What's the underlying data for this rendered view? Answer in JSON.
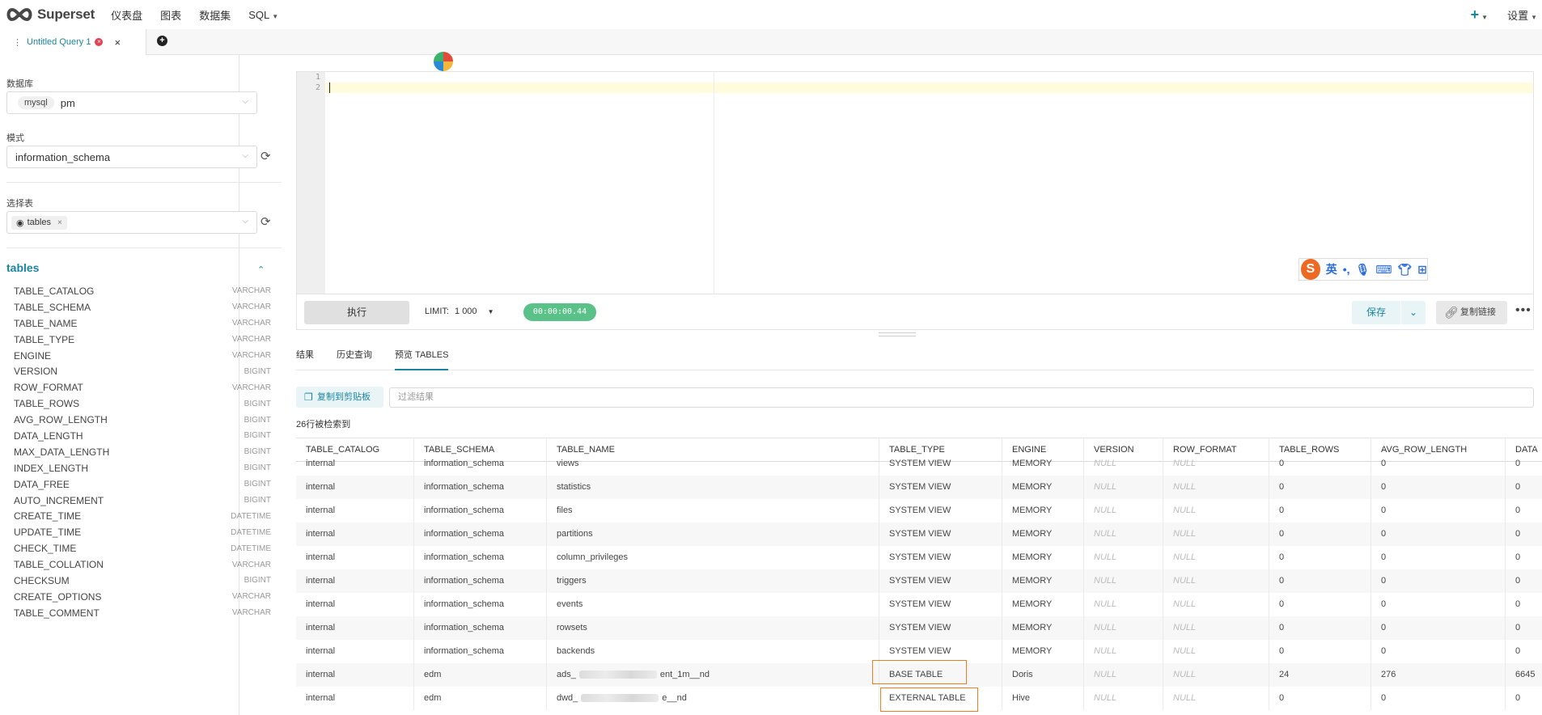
{
  "nav": {
    "brand": "Superset",
    "items": [
      "仪表盘",
      "图表",
      "数据集",
      "SQL"
    ],
    "plus": "+",
    "settings": "设置"
  },
  "tab": {
    "label": "Untitled Query 1",
    "close": "×",
    "add": "+"
  },
  "left": {
    "database_label": "数据库",
    "database_chip": "mysql",
    "database_name": "pm",
    "schema_label": "模式",
    "schema_value": "information_schema",
    "table_label": "选择表",
    "table_chip": "tables",
    "table_chip_remove": "×",
    "tables_header": "tables",
    "columns": [
      {
        "name": "TABLE_CATALOG",
        "type": "VARCHAR"
      },
      {
        "name": "TABLE_SCHEMA",
        "type": "VARCHAR"
      },
      {
        "name": "TABLE_NAME",
        "type": "VARCHAR"
      },
      {
        "name": "TABLE_TYPE",
        "type": "VARCHAR"
      },
      {
        "name": "ENGINE",
        "type": "VARCHAR"
      },
      {
        "name": "VERSION",
        "type": "BIGINT"
      },
      {
        "name": "ROW_FORMAT",
        "type": "VARCHAR"
      },
      {
        "name": "TABLE_ROWS",
        "type": "BIGINT"
      },
      {
        "name": "AVG_ROW_LENGTH",
        "type": "BIGINT"
      },
      {
        "name": "DATA_LENGTH",
        "type": "BIGINT"
      },
      {
        "name": "MAX_DATA_LENGTH",
        "type": "BIGINT"
      },
      {
        "name": "INDEX_LENGTH",
        "type": "BIGINT"
      },
      {
        "name": "DATA_FREE",
        "type": "BIGINT"
      },
      {
        "name": "AUTO_INCREMENT",
        "type": "BIGINT"
      },
      {
        "name": "CREATE_TIME",
        "type": "DATETIME"
      },
      {
        "name": "UPDATE_TIME",
        "type": "DATETIME"
      },
      {
        "name": "CHECK_TIME",
        "type": "DATETIME"
      },
      {
        "name": "TABLE_COLLATION",
        "type": "VARCHAR"
      },
      {
        "name": "CHECKSUM",
        "type": "BIGINT"
      },
      {
        "name": "CREATE_OPTIONS",
        "type": "VARCHAR"
      },
      {
        "name": "TABLE_COMMENT",
        "type": "VARCHAR"
      }
    ]
  },
  "editor": {
    "line_numbers": [
      "1",
      "2"
    ]
  },
  "ime": {
    "logo": "S",
    "lang": "英",
    "punct": "•,"
  },
  "toolbar": {
    "run": "执行",
    "limit_label": "LIMIT:",
    "limit_value": "1 000",
    "timer": "00:00:00.44",
    "save": "保存",
    "copy_link": "复制链接",
    "more": "•••"
  },
  "results": {
    "tabs": [
      "结果",
      "历史查询",
      "预览 TABLES"
    ],
    "copy_clipboard": "复制到剪贴板",
    "filter_placeholder": "过滤结果",
    "row_count": "26行被检索到",
    "columns": [
      "TABLE_CATALOG",
      "TABLE_SCHEMA",
      "TABLE_NAME",
      "TABLE_TYPE",
      "ENGINE",
      "VERSION",
      "ROW_FORMAT",
      "TABLE_ROWS",
      "AVG_ROW_LENGTH",
      "DATA"
    ],
    "rows": [
      [
        "internal",
        "information_schema",
        "views",
        "SYSTEM VIEW",
        "MEMORY",
        "NULL",
        "NULL",
        "0",
        "0",
        "0"
      ],
      [
        "internal",
        "information_schema",
        "statistics",
        "SYSTEM VIEW",
        "MEMORY",
        "NULL",
        "NULL",
        "0",
        "0",
        "0"
      ],
      [
        "internal",
        "information_schema",
        "files",
        "SYSTEM VIEW",
        "MEMORY",
        "NULL",
        "NULL",
        "0",
        "0",
        "0"
      ],
      [
        "internal",
        "information_schema",
        "partitions",
        "SYSTEM VIEW",
        "MEMORY",
        "NULL",
        "NULL",
        "0",
        "0",
        "0"
      ],
      [
        "internal",
        "information_schema",
        "column_privileges",
        "SYSTEM VIEW",
        "MEMORY",
        "NULL",
        "NULL",
        "0",
        "0",
        "0"
      ],
      [
        "internal",
        "information_schema",
        "triggers",
        "SYSTEM VIEW",
        "MEMORY",
        "NULL",
        "NULL",
        "0",
        "0",
        "0"
      ],
      [
        "internal",
        "information_schema",
        "events",
        "SYSTEM VIEW",
        "MEMORY",
        "NULL",
        "NULL",
        "0",
        "0",
        "0"
      ],
      [
        "internal",
        "information_schema",
        "rowsets",
        "SYSTEM VIEW",
        "MEMORY",
        "NULL",
        "NULL",
        "0",
        "0",
        "0"
      ],
      [
        "internal",
        "information_schema",
        "backends",
        "SYSTEM VIEW",
        "MEMORY",
        "NULL",
        "NULL",
        "0",
        "0",
        "0"
      ],
      [
        "internal",
        "edm",
        "ads_",
        "BASE TABLE",
        "Doris",
        "NULL",
        "NULL",
        "24",
        "276",
        "6645"
      ],
      [
        "internal",
        "edm",
        "dwd_",
        "EXTERNAL TABLE",
        "Hive",
        "NULL",
        "NULL",
        "0",
        "0",
        "0"
      ]
    ],
    "redacted_suffix": [
      "ent_1m__nd",
      "e__nd"
    ]
  }
}
